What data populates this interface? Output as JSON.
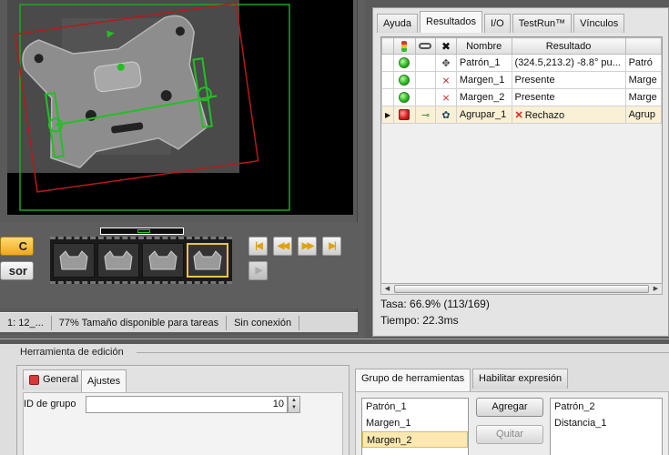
{
  "left_pane": {
    "start_button_label": "C",
    "sensor_button_label": "sor",
    "status": {
      "cell_1": "1: 12_...",
      "cell_2": "77% Tamaño disponible para tareas",
      "cell_3": "Sin conexión"
    },
    "nav_glyphs": {
      "first": "|◀",
      "prev": "◀◀",
      "next": "▶▶",
      "last": "▶|",
      "play": "▶"
    }
  },
  "results": {
    "tabs": [
      {
        "label": "Ayuda",
        "active": false
      },
      {
        "label": "Resultados",
        "active": true
      },
      {
        "label": "I/O",
        "active": false
      },
      {
        "label": "TestRun™",
        "active": false
      },
      {
        "label": "Vínculos",
        "active": false
      }
    ],
    "columns": {
      "status": "",
      "link": "",
      "tool": "",
      "name": "Nombre",
      "result": "Resultado",
      "extra": ""
    },
    "rows": [
      {
        "name": "Patrón_1",
        "result": "(324.5,213.2) -8.8° pu...",
        "extra": "Patró",
        "status": "pass",
        "fail_mark": ""
      },
      {
        "name": "Margen_1",
        "result": "Presente",
        "extra": "Marge",
        "status": "pass",
        "fail_mark": ""
      },
      {
        "name": "Margen_2",
        "result": "Presente",
        "extra": "Marge",
        "status": "pass",
        "fail_mark": ""
      },
      {
        "name": "Agrupar_1",
        "result": "Rechazo",
        "extra": "Agrup",
        "status": "fail",
        "fail_mark": "✕"
      }
    ],
    "rate": "Tasa: 66.9% (113/169)",
    "time": "Tiempo: 22.3ms"
  },
  "edit_tool": {
    "title": "Herramienta de edición",
    "config_tabs": {
      "general": "General",
      "settings": "Ajustes"
    },
    "group_id_label": "ID de grupo",
    "group_id_value": "10",
    "group_tabs": {
      "group": "Grupo de herramientas",
      "enable": "Habilitar expresión"
    },
    "available_tools": [
      "Patrón_1",
      "Margen_1",
      "Margen_2"
    ],
    "selected_available": "Margen_2",
    "add_label": "Agregar",
    "remove_label": "Quitar",
    "group_members": [
      "Patrón_2",
      "Distancia_1"
    ]
  },
  "colors": {
    "pass": "#23b51c",
    "fail": "#d71c1c",
    "highlight_row": "#faf0d5",
    "accent_button": "#f0a820"
  }
}
